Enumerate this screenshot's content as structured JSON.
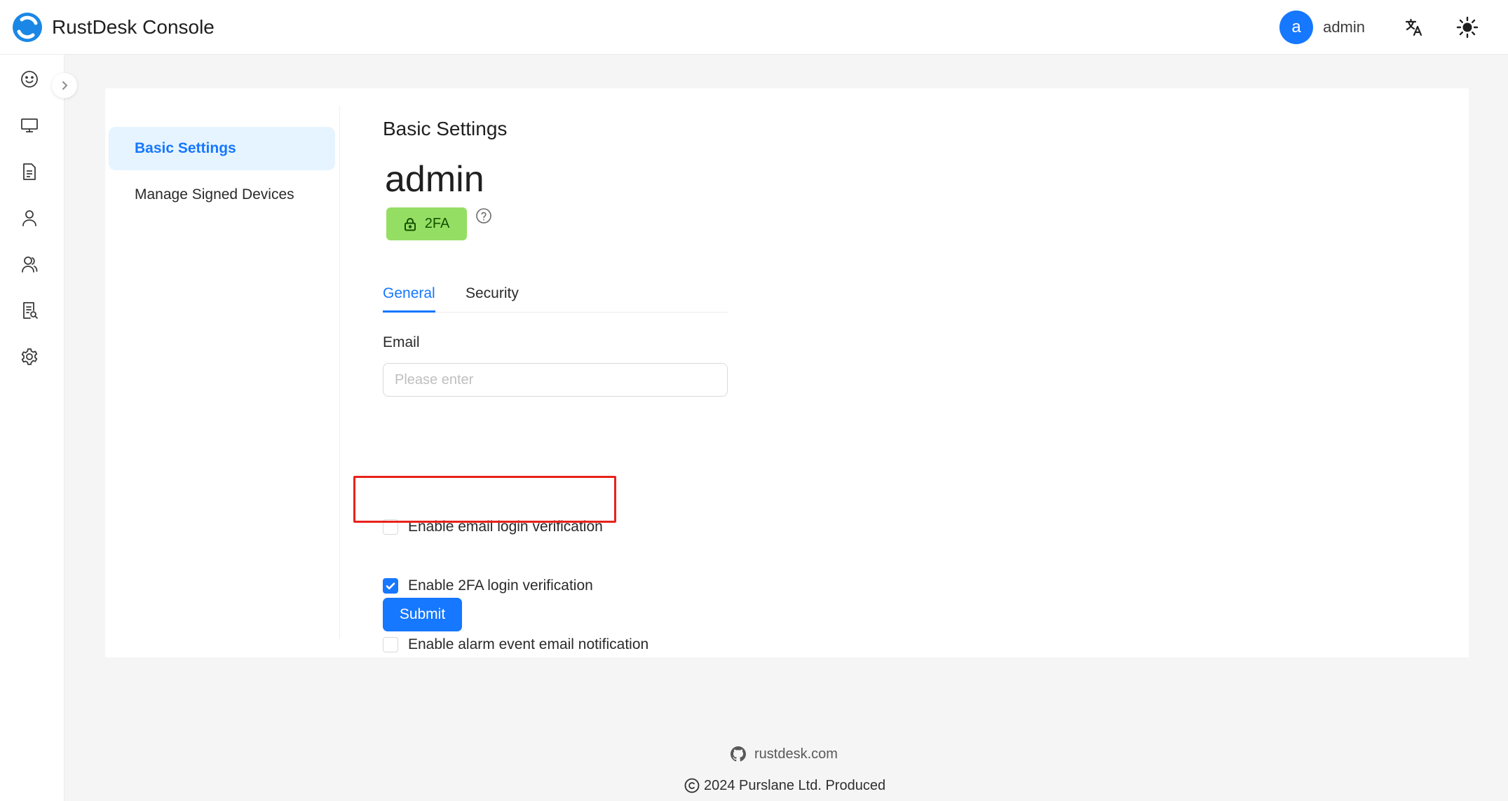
{
  "app": {
    "title": "RustDesk Console"
  },
  "header": {
    "avatar_initial": "a",
    "username": "admin",
    "language_icon": "translate-icon",
    "theme_icon": "sun-icon"
  },
  "rail": {
    "items": [
      {
        "icon": "smiley-icon"
      },
      {
        "icon": "monitor-icon"
      },
      {
        "icon": "document-icon"
      },
      {
        "icon": "user-icon"
      },
      {
        "icon": "users-icon"
      },
      {
        "icon": "audit-log-icon"
      },
      {
        "icon": "gear-icon"
      }
    ],
    "collapse_icon": "chevron-right-icon"
  },
  "settings_menu": {
    "items": [
      {
        "label": "Basic Settings",
        "active": true
      },
      {
        "label": "Manage Signed Devices",
        "active": false
      }
    ]
  },
  "main": {
    "title": "Basic Settings",
    "profile_name": "admin",
    "badge": {
      "label": "2FA",
      "icon": "lock-icon"
    },
    "help_icon": "question-circle-icon",
    "tabs": [
      {
        "label": "General",
        "active": true
      },
      {
        "label": "Security",
        "active": false
      }
    ],
    "email": {
      "label": "Email",
      "value": "",
      "placeholder": "Please enter"
    },
    "options": [
      {
        "label": "Enable email login verification",
        "checked": false
      },
      {
        "label": "Enable 2FA login verification",
        "checked": true
      },
      {
        "label": "Enable alarm event email notification",
        "checked": false
      }
    ],
    "submit_label": "Submit"
  },
  "footer": {
    "link_text": "rustdesk.com",
    "link_icon": "github-icon",
    "copyright": "2024 Purslane Ltd. Produced",
    "copyright_icon": "copyright-icon"
  },
  "colors": {
    "accent": "#1677ff",
    "badge_bg": "#95de64",
    "highlight": "#e8221b",
    "active_menu_bg": "#e6f4ff"
  }
}
